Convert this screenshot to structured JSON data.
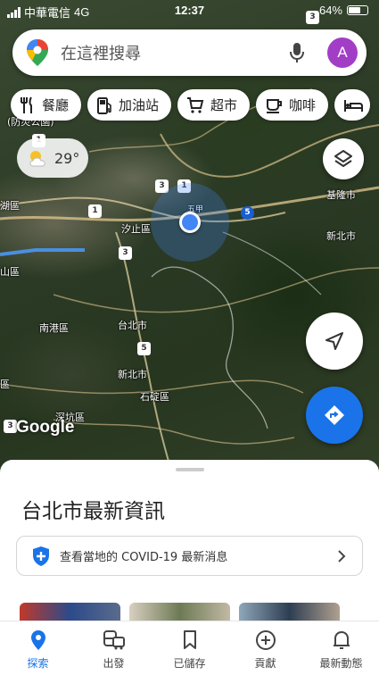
{
  "status_bar": {
    "carrier": "中華電信",
    "network": "4G",
    "time": "12:37",
    "battery": "64%"
  },
  "search": {
    "placeholder": "在這裡搜尋",
    "avatar_letter": "A"
  },
  "chips": [
    {
      "label": "餐廳",
      "icon": "restaurant-icon"
    },
    {
      "label": "加油站",
      "icon": "gas-station-icon"
    },
    {
      "label": "超市",
      "icon": "cart-icon"
    },
    {
      "label": "咖啡",
      "icon": "coffee-icon"
    }
  ],
  "weather": {
    "temperature": "29°",
    "icon": "partly-cloudy-icon"
  },
  "map": {
    "labels": {
      "xizhi": "汐止區",
      "keelung": "基隆市",
      "new_taipei_1": "新北市",
      "nangang": "南港區",
      "taipei": "台北市",
      "new_taipei_2": "新北市",
      "shiding": "石碇區",
      "shenkeng": "深坑區",
      "top_park": "(防災公園)",
      "edge_hu": "湖區",
      "edge_shan": "山區",
      "edge_ju": "區",
      "wugu": "五甲"
    },
    "shields": {
      "s1": "1",
      "s2": "1",
      "s3": "3",
      "s4": "3",
      "s5": "5",
      "s6": "5",
      "s7": "3",
      "s8": "3",
      "s9": "1"
    },
    "watermark": "Google"
  },
  "sheet": {
    "title": "台北市最新資訊",
    "covid_text": "查看當地的 COVID-19 最新消息"
  },
  "nav": [
    {
      "label": "探索",
      "icon": "explore-pin-icon",
      "active": true
    },
    {
      "label": "出發",
      "icon": "commute-icon"
    },
    {
      "label": "已儲存",
      "icon": "bookmark-icon"
    },
    {
      "label": "貢獻",
      "icon": "add-circle-icon"
    },
    {
      "label": "最新動態",
      "icon": "bell-icon"
    }
  ],
  "colors": {
    "accent": "#1a73e8",
    "avatar": "#a23ec6",
    "location": "#4285f4"
  }
}
